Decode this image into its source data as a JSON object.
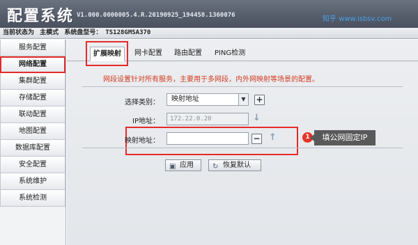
{
  "header": {
    "title": "配置系统",
    "version": "V1.000.0000005.4.R.20190925_194458.1360076",
    "watermark": "知乎 www.isbsv.com"
  },
  "status": {
    "state_label": "当前状态为",
    "mode": "主模式",
    "model_label": "系统盘型号：",
    "model_value": "TS128GMSA370"
  },
  "sidebar": {
    "items": [
      {
        "label": "服务配置"
      },
      {
        "label": "网络配置"
      },
      {
        "label": "集群配置"
      },
      {
        "label": "存储配置"
      },
      {
        "label": "联动配置"
      },
      {
        "label": "地图配置"
      },
      {
        "label": "数据库配置"
      },
      {
        "label": "安全配置"
      },
      {
        "label": "系统维护"
      },
      {
        "label": "系统检测"
      }
    ],
    "active_index": 1
  },
  "tabs": [
    {
      "label": "扩展映射"
    },
    {
      "label": "网卡配置"
    },
    {
      "label": "路由配置"
    },
    {
      "label": "PING检测"
    }
  ],
  "notice": "网段设置针对所有服务，主要用于多网段，内外网映射等场景的配置。",
  "form": {
    "type_label": "选择类别：",
    "type_value": "映射地址",
    "ip_label": "IP地址：",
    "ip_value": "172.22.0.20",
    "map_label": "映射地址：",
    "map_value": ""
  },
  "annotation": {
    "number": "1",
    "text": "填公网固定IP"
  },
  "buttons": {
    "apply": "应用",
    "restore": "恢复默认"
  },
  "colors": {
    "header_bg": "#5a6270",
    "highlight": "#e62a2a",
    "notice_text": "#d23a1e"
  }
}
